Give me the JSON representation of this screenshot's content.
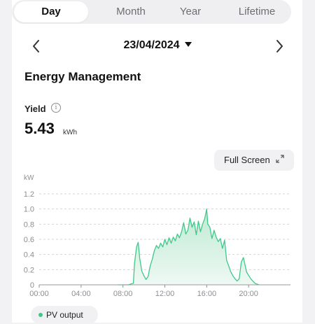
{
  "tabs": [
    {
      "label": "Day",
      "active": true
    },
    {
      "label": "Month",
      "active": false
    },
    {
      "label": "Year",
      "active": false
    },
    {
      "label": "Lifetime",
      "active": false
    }
  ],
  "date": {
    "value": "23/04/2024",
    "prev_icon": "chevron-left-icon",
    "next_icon": "chevron-right-icon",
    "dropdown_icon": "caret-down-icon"
  },
  "section_title": "Energy Management",
  "yield": {
    "label": "Yield",
    "info_icon": "info-icon",
    "info_glyph": "i",
    "value": "5.43",
    "unit": "kWh"
  },
  "full_screen": {
    "label": "Full Screen",
    "icon": "expand-icon"
  },
  "legend": {
    "label": "PV output",
    "color": "#3ec98a"
  },
  "colors": {
    "accent": "#3ec98a",
    "fill_top": "#bfead4",
    "fill_bottom": "#eef9f3",
    "grid": "#d5d5d9",
    "axis": "#8e8e93"
  },
  "chart_data": {
    "type": "area",
    "ylabel": "kW",
    "ylim": [
      0,
      1.2
    ],
    "y_ticks": [
      "0",
      "0.2",
      "0.4",
      "0.6",
      "0.8",
      "1.0",
      "1.2"
    ],
    "x_ticks": [
      "00:00",
      "04:00",
      "08:00",
      "12:00",
      "16:00",
      "20:00"
    ],
    "x_tick_hours": [
      0,
      4,
      8,
      12,
      16,
      20
    ],
    "x_range_hours": [
      0,
      24
    ],
    "grid": true,
    "series": [
      {
        "name": "PV output",
        "x_hours": [
          7.5,
          8.5,
          9.0,
          9.1,
          9.3,
          9.45,
          9.6,
          9.8,
          10.0,
          10.2,
          10.4,
          10.6,
          10.8,
          11.0,
          11.2,
          11.4,
          11.6,
          11.8,
          12.0,
          12.2,
          12.4,
          12.6,
          12.8,
          13.0,
          13.2,
          13.4,
          13.6,
          13.8,
          14.0,
          14.2,
          14.4,
          14.6,
          14.8,
          15.0,
          15.2,
          15.4,
          15.6,
          15.8,
          16.0,
          16.1,
          16.3,
          16.5,
          16.7,
          16.9,
          17.1,
          17.3,
          17.5,
          17.7,
          17.9,
          18.1,
          18.3,
          18.5,
          18.7,
          18.9,
          19.1,
          19.3,
          19.5,
          19.8,
          20.2,
          20.6,
          21.0
        ],
        "values": [
          0.0,
          0.0,
          0.02,
          0.28,
          0.5,
          0.56,
          0.35,
          0.18,
          0.12,
          0.07,
          0.11,
          0.25,
          0.34,
          0.45,
          0.52,
          0.48,
          0.55,
          0.5,
          0.6,
          0.53,
          0.62,
          0.55,
          0.63,
          0.58,
          0.67,
          0.62,
          0.7,
          0.82,
          0.67,
          0.72,
          0.88,
          0.76,
          0.83,
          0.66,
          0.84,
          0.7,
          0.8,
          0.87,
          1.0,
          0.8,
          0.76,
          0.61,
          0.72,
          0.63,
          0.57,
          0.61,
          0.48,
          0.59,
          0.32,
          0.25,
          0.17,
          0.12,
          0.08,
          0.05,
          0.08,
          0.3,
          0.36,
          0.17,
          0.08,
          0.02,
          0.0
        ]
      }
    ]
  }
}
